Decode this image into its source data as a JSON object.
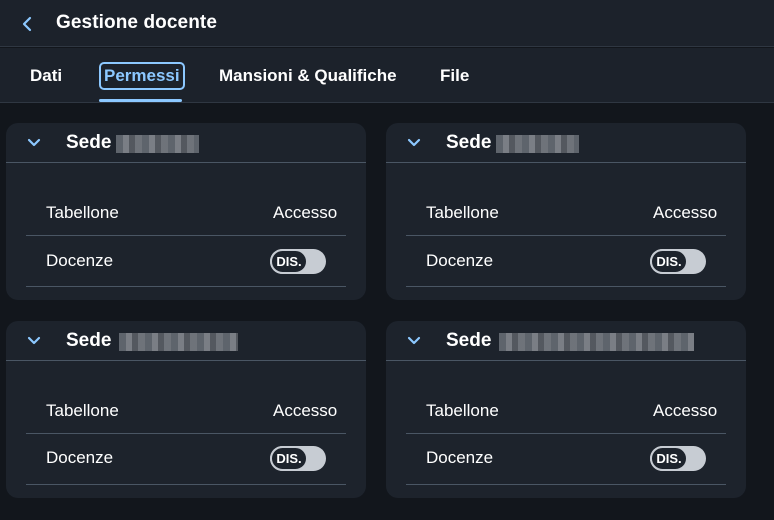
{
  "header": {
    "title": "Gestione docente",
    "back_icon": "chevron-left-icon"
  },
  "tabs": [
    {
      "label": "Dati",
      "active": false
    },
    {
      "label": "Permessi",
      "active": true
    },
    {
      "label": "Mansioni & Qualifiche",
      "active": false
    },
    {
      "label": "File",
      "active": false
    }
  ],
  "colors": {
    "accent": "#8cc8ff",
    "background": "#12161c",
    "card": "#1d232c"
  },
  "sedi": [
    {
      "title": "Sede",
      "name_redacted": true,
      "columns": {
        "tabellone": "Tabellone",
        "accesso": "Accesso"
      },
      "rows": [
        {
          "label": "Docenze",
          "toggle": "DIS."
        }
      ]
    },
    {
      "title": "Sede",
      "name_redacted": true,
      "columns": {
        "tabellone": "Tabellone",
        "accesso": "Accesso"
      },
      "rows": [
        {
          "label": "Docenze",
          "toggle": "DIS."
        }
      ]
    },
    {
      "title": "Sede",
      "name_redacted": true,
      "columns": {
        "tabellone": "Tabellone",
        "accesso": "Accesso"
      },
      "rows": [
        {
          "label": "Docenze",
          "toggle": "DIS."
        }
      ]
    },
    {
      "title": "Sede",
      "name_redacted": true,
      "columns": {
        "tabellone": "Tabellone",
        "accesso": "Accesso"
      },
      "rows": [
        {
          "label": "Docenze",
          "toggle": "DIS."
        }
      ]
    }
  ]
}
